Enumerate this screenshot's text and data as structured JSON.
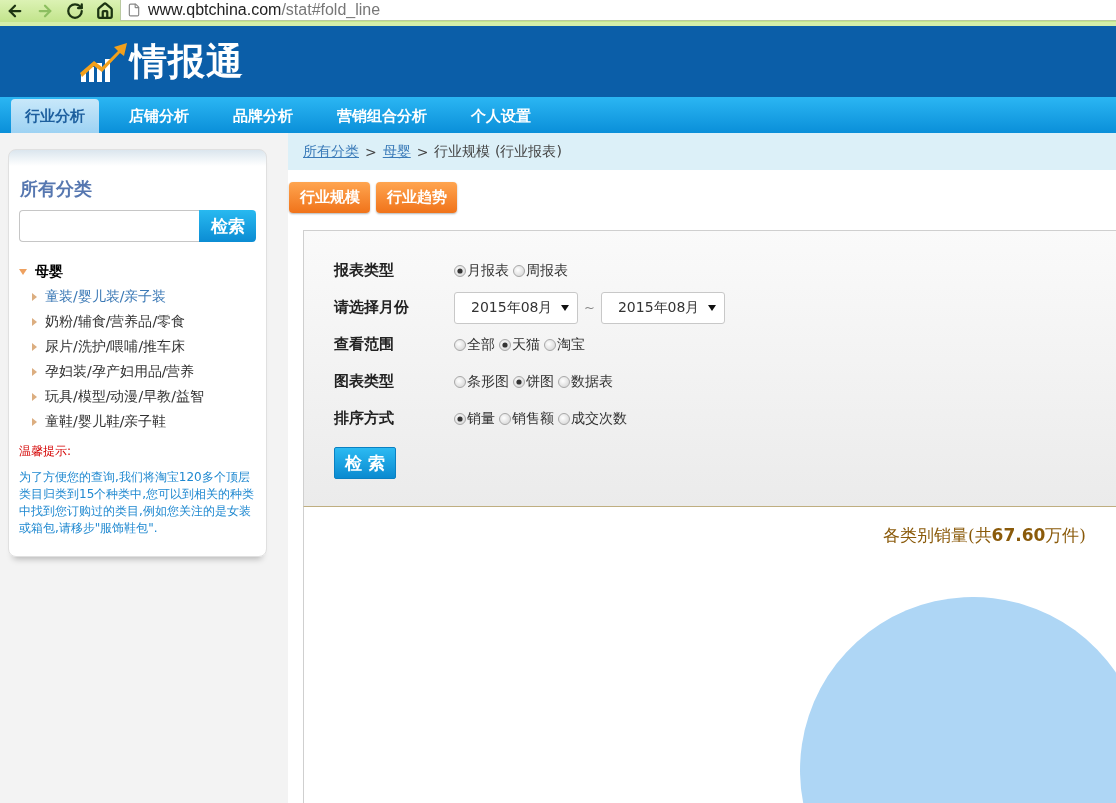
{
  "browser": {
    "buttons": [
      {
        "kind": "back",
        "disabled": false
      },
      {
        "kind": "forward",
        "disabled": true
      },
      {
        "kind": "reload",
        "disabled": false
      },
      {
        "kind": "home",
        "disabled": false
      }
    ],
    "url_host": "www.qbtchina.com",
    "url_path": "/stat#fold_line"
  },
  "header": {
    "logo_text": "情报通"
  },
  "nav": [
    {
      "label": "行业分析",
      "selected": true
    },
    {
      "label": "店铺分析",
      "selected": false
    },
    {
      "label": "品牌分析",
      "selected": false
    },
    {
      "label": "营销组合分析",
      "selected": false
    },
    {
      "label": "个人设置",
      "selected": false
    }
  ],
  "sidebar": {
    "title": "所有分类",
    "search_button": "检索",
    "tree": [
      {
        "label": "母婴",
        "expanded": true,
        "children": [
          {
            "label": "童装/婴儿装/亲子装",
            "selected": true
          },
          {
            "label": "奶粉/辅食/营养品/零食",
            "selected": false
          },
          {
            "label": "尿片/洗护/喂哺/推车床",
            "selected": false
          },
          {
            "label": "孕妇装/孕产妇用品/营养",
            "selected": false
          },
          {
            "label": "玩具/模型/动漫/早教/益智",
            "selected": false
          },
          {
            "label": "童鞋/婴儿鞋/亲子鞋",
            "selected": false
          }
        ]
      }
    ],
    "tip_title": "温馨提示:",
    "tip_text": "为了方便您的查询,我们将淘宝120多个顶层类目归类到15个种类中,您可以到相关的种类中找到您订购过的类目,例如您关注的是女装或箱包,请移步\"服饰鞋包\"."
  },
  "breadcrumb": [
    {
      "kind": "link",
      "text": "所有分类"
    },
    {
      "kind": "separator",
      "text": ">"
    },
    {
      "kind": "link",
      "text": "母婴"
    },
    {
      "kind": "separator",
      "text": ">"
    },
    {
      "kind": "current",
      "text": "行业规模 (行业报表)"
    }
  ],
  "sub_tabs": [
    "行业规模",
    "行业趋势"
  ],
  "form": {
    "rows": [
      {
        "kind": "radio",
        "label": "报表类型",
        "options": [
          {
            "label": "月报表",
            "selected": true
          },
          {
            "label": "周报表",
            "selected": false
          }
        ]
      },
      {
        "kind": "range",
        "label": "请选择月份",
        "from": "2015年08月",
        "separator": "~",
        "to": "2015年08月"
      },
      {
        "kind": "radio",
        "label": "查看范围",
        "options": [
          {
            "label": "全部",
            "selected": false
          },
          {
            "label": "天猫",
            "selected": true
          },
          {
            "label": "淘宝",
            "selected": false
          }
        ]
      },
      {
        "kind": "radio",
        "label": "图表类型",
        "options": [
          {
            "label": "条形图",
            "selected": false
          },
          {
            "label": "饼图",
            "selected": true
          },
          {
            "label": "数据表",
            "selected": false
          }
        ]
      },
      {
        "kind": "radio",
        "label": "排序方式",
        "options": [
          {
            "label": "销量",
            "selected": true
          },
          {
            "label": "销售额",
            "selected": false
          },
          {
            "label": "成交次数",
            "selected": false
          }
        ]
      }
    ],
    "submit": "检 索"
  },
  "chart": {
    "title": "各类别销量(共**67.60**万件)"
  }
}
